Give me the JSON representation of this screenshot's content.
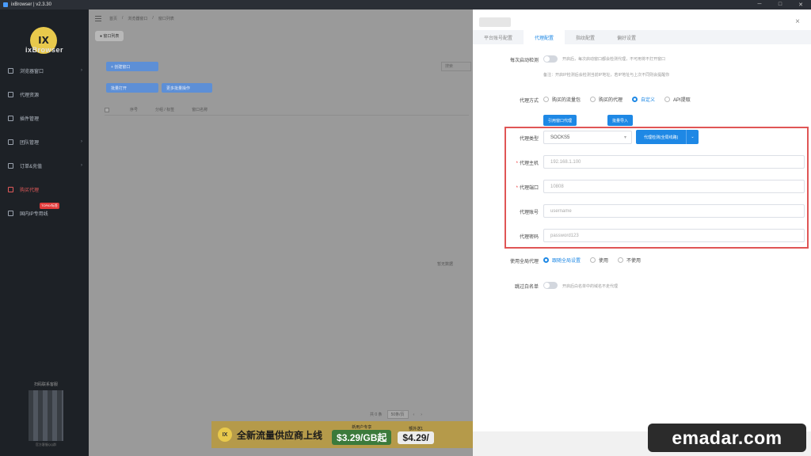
{
  "titlebar": {
    "title": "ixBrowser | v2.3.30",
    "min": "─",
    "max": "□",
    "close": "✕"
  },
  "sidebar": {
    "logo_glyph": "IX",
    "logo_text": "ixBrowser",
    "items": [
      {
        "label": "浏览器窗口",
        "arrow": "›"
      },
      {
        "label": "代理资源",
        "arrow": ""
      },
      {
        "label": "插件管理",
        "arrow": ""
      },
      {
        "label": "团队管理",
        "arrow": "›"
      },
      {
        "label": "订单&充值",
        "arrow": "›"
      },
      {
        "label": "购买代理",
        "arrow": ""
      },
      {
        "label": "国内IP专用线",
        "arrow": "",
        "badge": "TOPAY标签"
      }
    ],
    "bottom_title": "扫码联系客服",
    "bottom_footer": "官方客服QQ群"
  },
  "main": {
    "crumbs": [
      "首页",
      "/",
      "浏览器窗口",
      "/",
      "窗口列表"
    ],
    "tab_chip": "● 窗口列表",
    "create_btn": "+ 创建窗口",
    "batch_open_btn": "批量打开",
    "more_btn": "更多批量操作",
    "search_placeholder": "搜索",
    "columns": [
      "序号",
      "分组 / 标签",
      "窗口名称"
    ],
    "empty_text": "暂无数据",
    "pager_total": "共 0 条",
    "pager_size": "50条/页",
    "pager_prev": "‹",
    "pager_next": "›",
    "banner_logo": "IX",
    "banner_text": "全新流量供应商上线",
    "price1_label": "新用户专享",
    "price1_value": "$3.29/GB起",
    "price2_label": "额外送1",
    "price2_value": "$4.29/"
  },
  "drawer": {
    "close": "×",
    "tabs": [
      "平台账号配置",
      "代理配置",
      "指纹配置",
      "偏好设置"
    ],
    "auto_detect_label": "每次启动检测",
    "auto_detect_hint": "开启后，每次启动窗口都会检测代理，不可用将不打开窗口",
    "auto_detect_sub": "备注：开启IP检测后会检测当前IP地址，若IP地址与上次不同则会提醒你",
    "proxy_mode_label": "代理方式",
    "proxy_modes": [
      "购买的流量包",
      "购买的代理",
      "自定义",
      "API提取"
    ],
    "btn_use_window_proxy": "引用窗口代理",
    "btn_batch_import": "批量导入",
    "proxy_type_label": "代理类型",
    "proxy_type_value": "SOCKS5",
    "check_proxy_btn": "代理检测(全局线路)",
    "check_proxy_caret": "⌄",
    "host_label": "代理主机",
    "host_value": "192.168.1.100",
    "port_label": "代理端口",
    "port_value": "10808",
    "account_label": "代理账号",
    "account_value": "username",
    "password_label": "代理密码",
    "password_value": "password123",
    "bypass_label": "使用全局代理",
    "bypass_options": [
      "跟随全局设置",
      "使用",
      "不使用"
    ],
    "whitelist_label": "跳过白名单",
    "whitelist_hint": "开启后白名单中的域名不走代理"
  },
  "watermark": "emadar.com"
}
